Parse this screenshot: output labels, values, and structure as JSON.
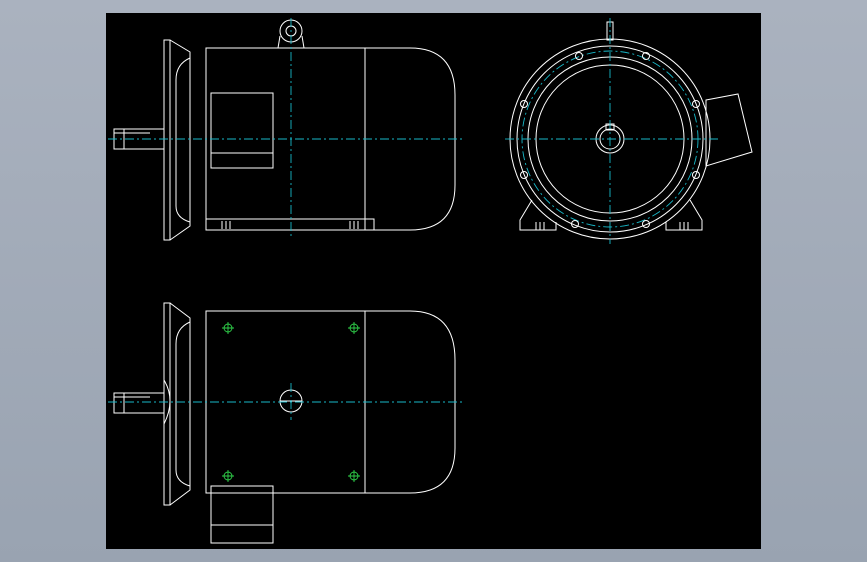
{
  "drawing": {
    "background_color": "#000000",
    "frame_color": "#a3acb9",
    "line_color": "#ffffff",
    "centerline_color": "#18b8c8",
    "hole_color": "#2fd24a"
  },
  "views": [
    {
      "id": "side-view",
      "description": ""
    },
    {
      "id": "end-view",
      "description": ""
    },
    {
      "id": "top-view",
      "description": ""
    }
  ]
}
